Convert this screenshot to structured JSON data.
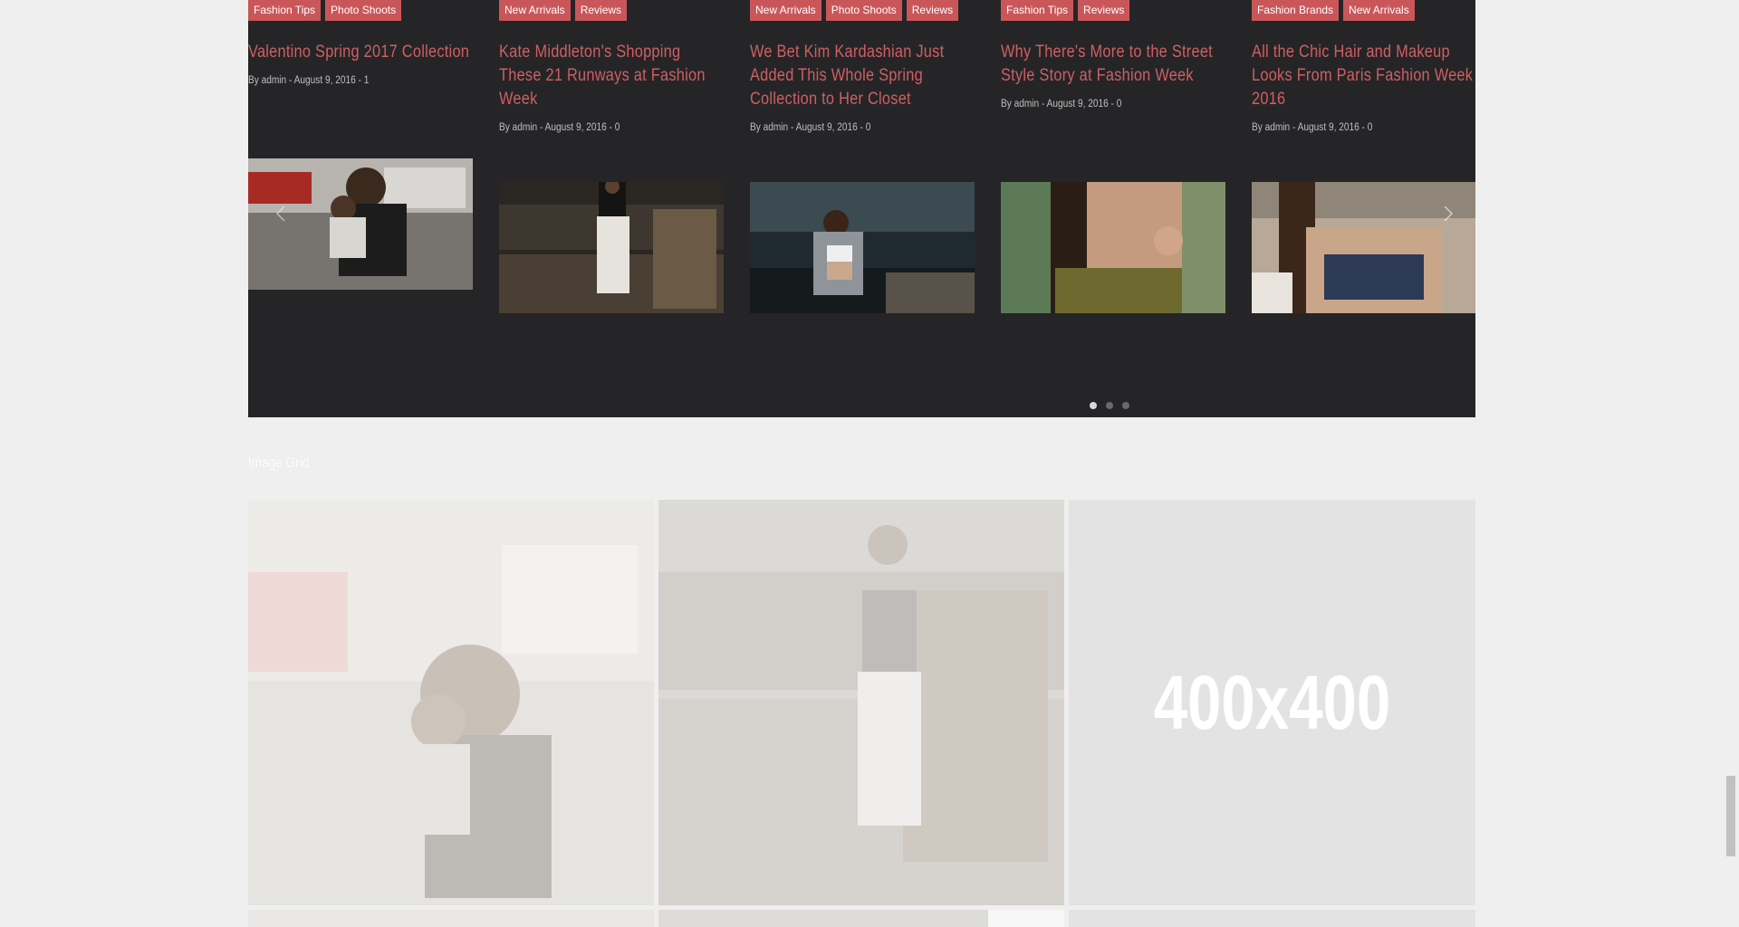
{
  "carousel": {
    "posts": [
      {
        "tags": [
          "Fashion Tips",
          "Photo Shoots"
        ],
        "title": "Valentino Spring 2017 Collection",
        "meta": "By admin - August 9, 2016 - 1"
      },
      {
        "tags": [
          "New Arrivals",
          "Reviews"
        ],
        "title": "Kate Middleton's Shopping These 21 Runways at Fashion Week",
        "meta": "By admin - August 9, 2016 - 0"
      },
      {
        "tags": [
          "New Arrivals",
          "Photo Shoots",
          "Reviews"
        ],
        "title": "We Bet Kim Kardashian Just Added This Whole Spring Collection to Her Closet",
        "meta": "By admin - August 9, 2016 - 0"
      },
      {
        "tags": [
          "Fashion Tips",
          "Reviews"
        ],
        "title": "Why There's More to the Street Style Story at Fashion Week",
        "meta": "By admin - August 9, 2016 - 0"
      },
      {
        "tags": [
          "Fashion Brands",
          "New Arrivals"
        ],
        "title": "All the Chic Hair and Makeup Looks From Paris Fashion Week 2016",
        "meta": "By admin - August 9, 2016 - 0"
      }
    ],
    "prev_icon": "chevron-left-icon",
    "next_icon": "chevron-right-icon",
    "pagination": {
      "pages": 3,
      "active": 1
    }
  },
  "image_grid": {
    "title": "Image Grid",
    "placeholder_text": "400x400"
  },
  "colors": {
    "panel_bg": "#252527",
    "accent": "#c9575a",
    "page_bg": "#efefef"
  }
}
